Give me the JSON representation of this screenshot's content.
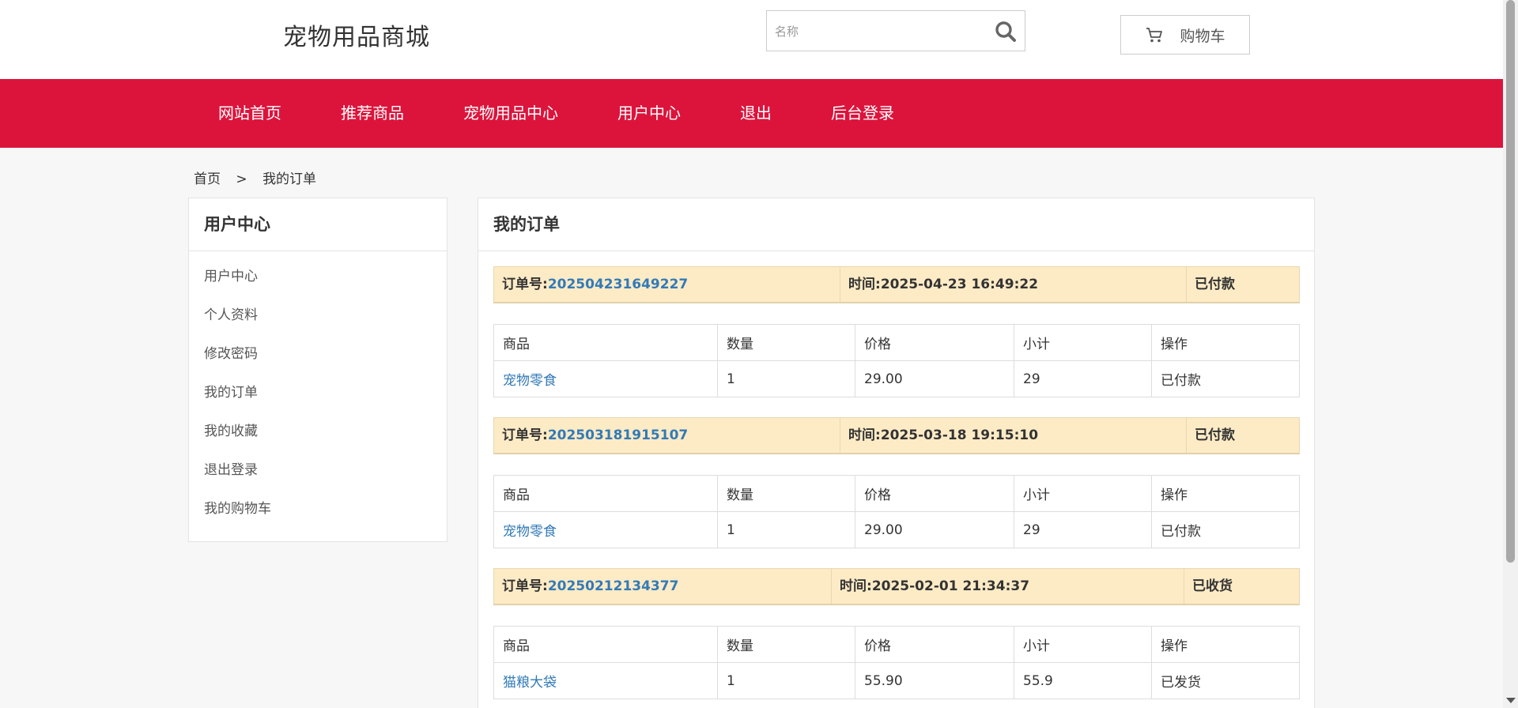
{
  "header": {
    "site_title": "宠物用品商城",
    "search_placeholder": "名称",
    "cart_label": "购物车"
  },
  "nav": {
    "items": [
      "网站首页",
      "推荐商品",
      "宠物用品中心",
      "用户中心",
      "退出",
      "后台登录"
    ]
  },
  "breadcrumb": {
    "home": "首页",
    "separator": ">",
    "current": "我的订单"
  },
  "sidebar": {
    "title": "用户中心",
    "items": [
      "用户中心",
      "个人资料",
      "修改密码",
      "我的订单",
      "我的收藏",
      "退出登录",
      "我的购物车"
    ]
  },
  "main": {
    "title": "我的订单",
    "columns": [
      "商品",
      "数量",
      "价格",
      "小计",
      "操作"
    ],
    "order_label": "订单号:",
    "time_label": "时间:",
    "orders": [
      {
        "order_no": "202504231649227",
        "time": "2025-04-23 16:49:22",
        "status": "已付款",
        "item": {
          "product": "宠物零食",
          "qty": "1",
          "price": "29.00",
          "subtotal": "29",
          "action": "已付款"
        }
      },
      {
        "order_no": "202503181915107",
        "time": "2025-03-18 19:15:10",
        "status": "已付款",
        "item": {
          "product": "宠物零食",
          "qty": "1",
          "price": "29.00",
          "subtotal": "29",
          "action": "已付款"
        }
      },
      {
        "order_no": "20250212134377",
        "time": "2025-02-01 21:34:37",
        "status": "已收货",
        "item": {
          "product": "猫粮大袋",
          "qty": "1",
          "price": "55.90",
          "subtotal": "55.9",
          "action": "已发货"
        }
      }
    ]
  },
  "colors": {
    "nav_bg": "#dc143c",
    "order_header_bg": "#fdebc6",
    "link": "#337ab7"
  }
}
